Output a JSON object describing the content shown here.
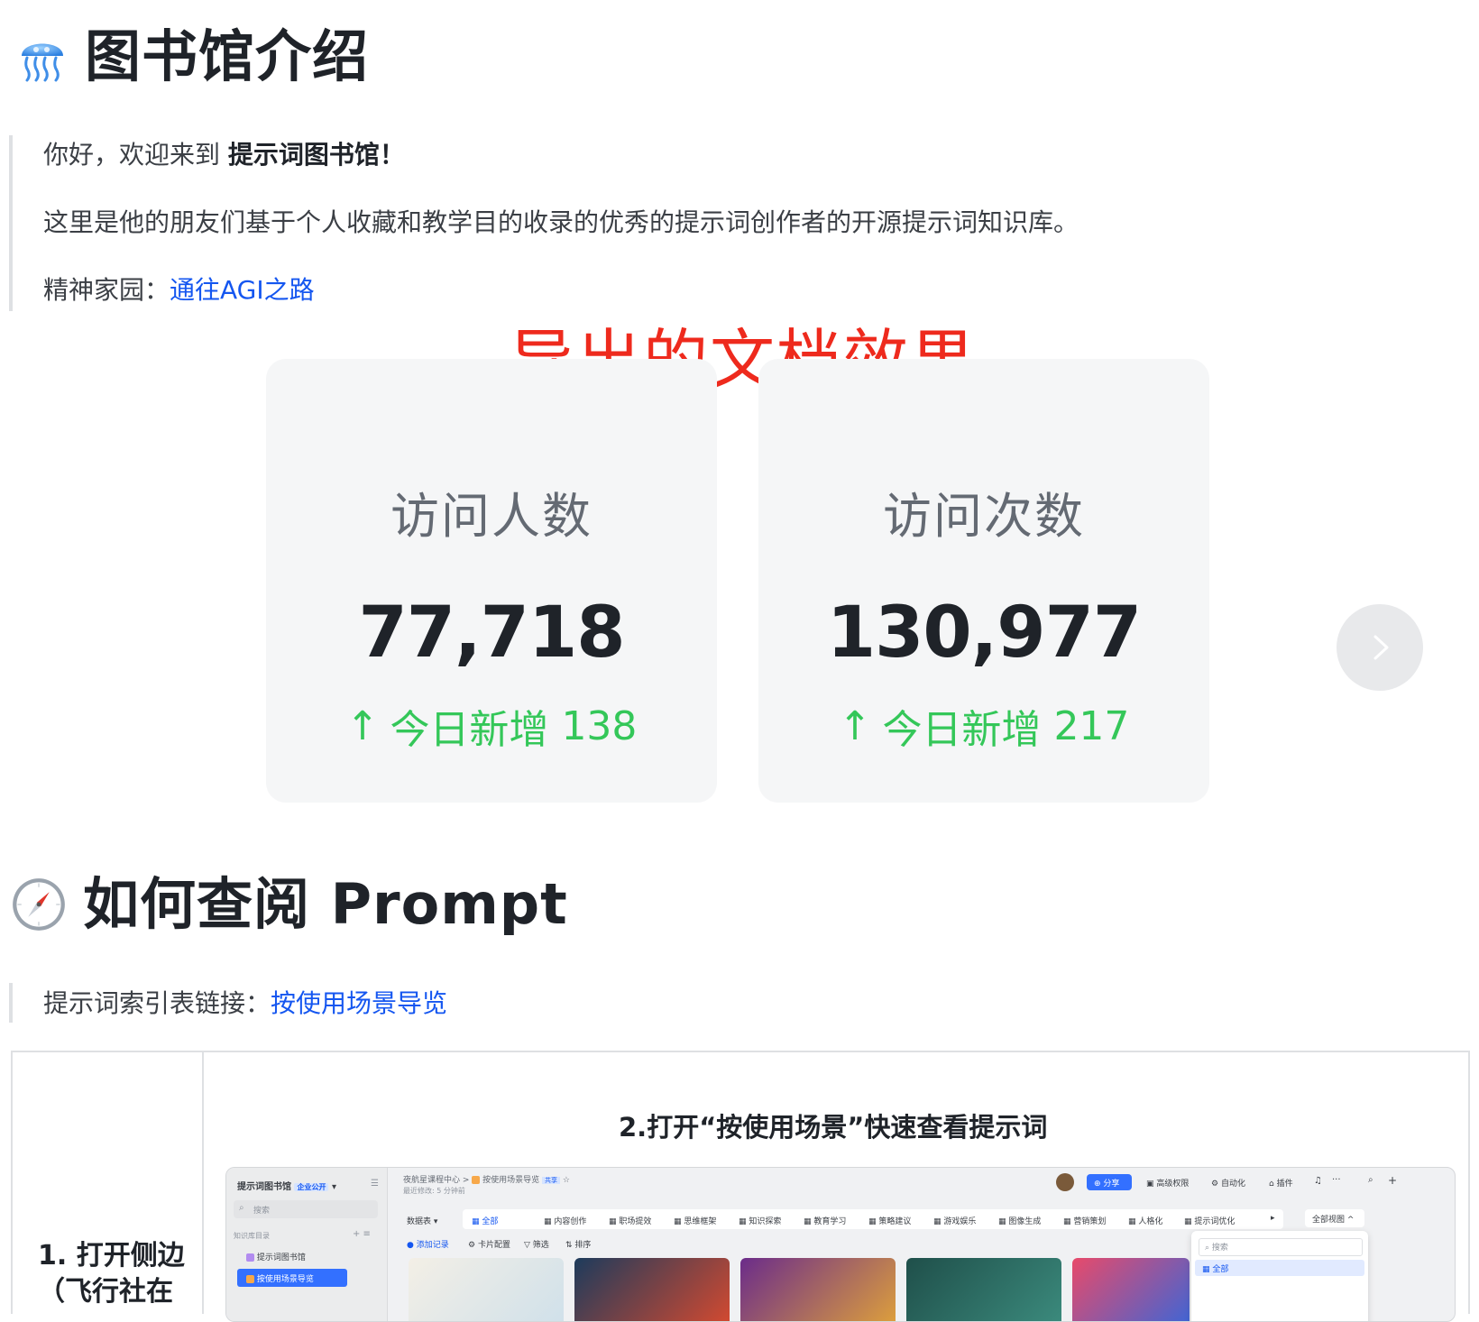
{
  "section1": {
    "title": "图书馆介绍",
    "icon": "jellyfish-icon",
    "quote": {
      "greeting_prefix": "你好，欢迎来到 ",
      "greeting_bold": "提示词图书馆！",
      "description": "这里是他的朋友们基于个人收藏和教学目的收录的优秀的提示词创作者的开源提示词知识库。",
      "home_prefix": "精神家园：",
      "home_link": "通往AGI之路"
    }
  },
  "annotation": "导出的文档效果",
  "stats": [
    {
      "label": "访问人数",
      "value": "77,718",
      "delta_prefix": "今日新增",
      "delta_value": "138"
    },
    {
      "label": "访问次数",
      "value": "130,977",
      "delta_prefix": "今日新增",
      "delta_value": "217"
    }
  ],
  "colors": {
    "accent_link": "#1456f0",
    "annotation": "#ee2a1d",
    "positive": "#34c759"
  },
  "section2": {
    "title": "如何查阅 Prompt",
    "icon": "compass-icon",
    "quote": {
      "prefix": "提示词索引表链接：",
      "link": "按使用场景导览"
    }
  },
  "table": {
    "left_step": "1. 打开侧边",
    "left_step_cont": "（飞行社在",
    "right_step": "2.打开“按使用场景”快速查看提示词"
  },
  "screenshot": {
    "sidebar_title": "提示词图书馆",
    "sidebar_badge": "企业公开",
    "search": "搜索",
    "kb_dir": "知识库目录",
    "item1": "提示词图书馆",
    "item2": "按使用场景导览",
    "breadcrumb_root": "夜航星课程中心",
    "breadcrumb_page": "按使用场景导览",
    "breadcrumb_tag": "共享",
    "last_edit": "最近修改: 5 分钟前",
    "share": "分享",
    "perm": "高级权限",
    "automation": "自动化",
    "plugins": "插件",
    "datasheet": "数据表",
    "tabs": [
      "全部",
      "内容创作",
      "职场提效",
      "思维框架",
      "知识探索",
      "教育学习",
      "策略建议",
      "游戏娱乐",
      "图像生成",
      "营销策划",
      "人格化",
      "提示词优化"
    ],
    "all_views": "全部视图",
    "add_record": "添加记录",
    "card_config": "卡片配置",
    "filter": "筛选",
    "sort": "排序",
    "dropdown_search": "搜索",
    "dropdown_all": "全部"
  }
}
